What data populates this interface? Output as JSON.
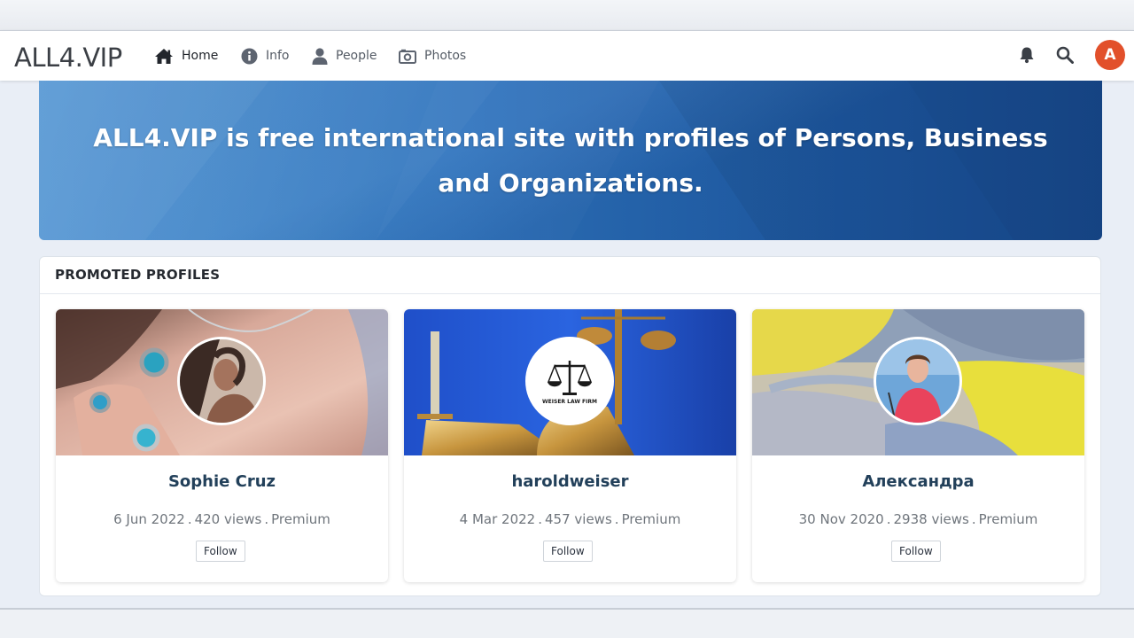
{
  "app": {
    "logo": "ALL4.VIP",
    "user_initial": "A"
  },
  "nav": {
    "items": [
      {
        "label": "Home",
        "icon": "home-icon",
        "active": true
      },
      {
        "label": "Info",
        "icon": "info-icon",
        "active": false
      },
      {
        "label": "People",
        "icon": "person-icon",
        "active": false
      },
      {
        "label": "Photos",
        "icon": "camera-icon",
        "active": false
      }
    ],
    "right_icons": [
      "bell-icon",
      "search-icon"
    ]
  },
  "hero": {
    "title": "ALL4.VIP is free international site with profiles of Persons, Business and Organizations."
  },
  "promoted": {
    "heading": "PROMOTED PROFILES",
    "cards": [
      {
        "name": "Sophie Cruz",
        "date": "6 Jun 2022",
        "views": "420 views",
        "tier": "Premium",
        "follow_label": "Follow"
      },
      {
        "name": "haroldweiser",
        "date": "4 Mar 2022",
        "views": "457 views",
        "tier": "Premium",
        "follow_label": "Follow",
        "avatar_caption": "WEISER LAW FIRM"
      },
      {
        "name": "Александра",
        "date": "30 Nov 2020",
        "views": "2938 views",
        "tier": "Premium",
        "follow_label": "Follow"
      }
    ]
  },
  "colors": {
    "hero_blue": "#2d72bd",
    "avatar_orange": "#e2502b",
    "name_color": "#22405a"
  }
}
